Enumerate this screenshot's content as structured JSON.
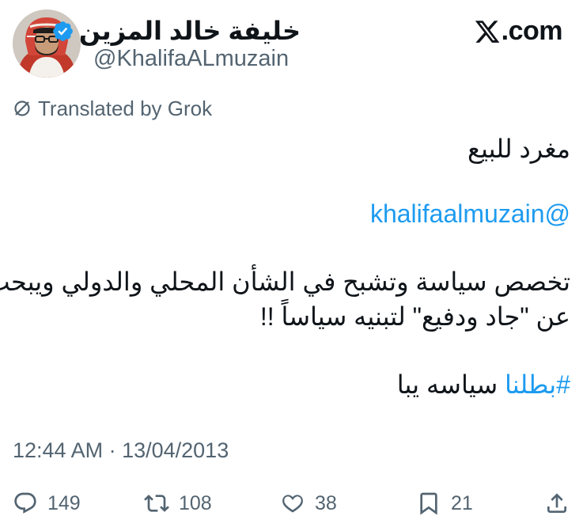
{
  "author": {
    "display_name": "خليفة خالد المزين",
    "handle": "@KhalifaALmuzain",
    "verified": true,
    "verified_color": "#1d9bf0"
  },
  "site": {
    "logo_text": ".com",
    "logo_icon": "x-logo-icon"
  },
  "translation": {
    "label": "Translated by Grok",
    "icon": "grok-icon"
  },
  "tweet": {
    "line1": "مغرد للبيع",
    "mention": "@khalifaalmuzain",
    "line3a": "تخصص سياسة وتشبح في الشأن المحلي والدولي ويبحث",
    "line3b": "عن \"جاد ودفيع\" لتبنيه سياساً !!",
    "hashtag": "#بطلنا",
    "hashtag_rest": " سياسه يبا",
    "link_color": "#1d9bf0"
  },
  "timestamp": "12:44 AM · 13/04/2013",
  "actions": {
    "replies": "149",
    "reposts": "108",
    "likes": "38",
    "bookmarks": "21"
  }
}
